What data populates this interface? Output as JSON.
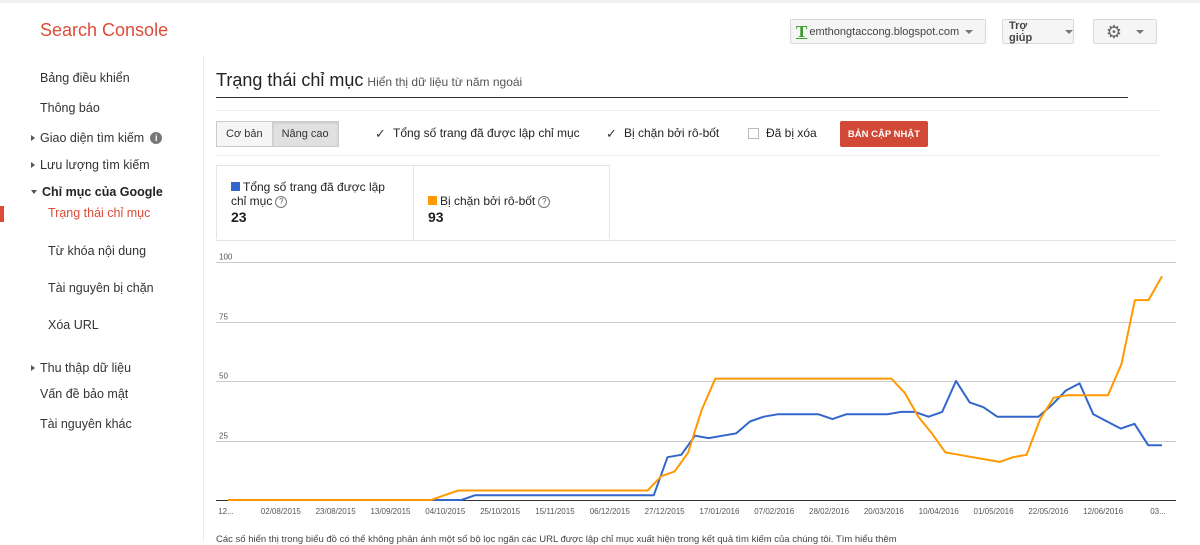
{
  "header": {
    "app_title": "Search Console",
    "site": "emthongtaccong.blogspot.com",
    "site_icon_letter": "T",
    "help_label": "Trợ giúp",
    "settings_icon": "gear-icon",
    "brand_color": "#dd4b39"
  },
  "sidebar": {
    "items": [
      {
        "label": "Bảng điều khiển"
      },
      {
        "label": "Thông báo"
      },
      {
        "label": "Giao diện tìm kiếm"
      },
      {
        "label": "Lưu lượng tìm kiếm"
      },
      {
        "label": "Chỉ mục của Google"
      },
      {
        "label": "Trạng thái chỉ mục"
      },
      {
        "label": "Từ khóa nội dung"
      },
      {
        "label": "Tài nguyên bị chặn"
      },
      {
        "label": "Xóa URL"
      },
      {
        "label": "Thu thập dữ liệu"
      },
      {
        "label": "Vấn đề bảo mật"
      },
      {
        "label": "Tài nguyên khác"
      }
    ]
  },
  "main": {
    "title": "Trạng thái chỉ mục",
    "subtitle": "Hiển thị dữ liệu từ năm ngoái",
    "tabs": [
      {
        "label": "Cơ bản"
      },
      {
        "label": "Nâng cao"
      }
    ],
    "checkboxes": [
      {
        "label": "Tổng số trang đã được lập chỉ mục",
        "checked": true
      },
      {
        "label": "Bị chặn bởi rô-bốt",
        "checked": true
      },
      {
        "label": "Đã bị xóa",
        "checked": false
      }
    ],
    "update_button": "BẢN CẬP NHẬT",
    "stats": [
      {
        "label": "Tổng số trang đã được lập chỉ mục",
        "value": "23",
        "color": "#3366cc"
      },
      {
        "label": "Bị chặn bởi rô-bốt",
        "value": "93",
        "color": "#ff9900"
      }
    ],
    "footnote": "Các số hiển thị trong biểu đồ có thể không phản ánh một số bộ lọc ngăn các URL được lập chỉ mục xuất hiện trong kết quả tìm kiếm của chúng tôi. Tìm hiểu thêm"
  },
  "chart_data": {
    "type": "line",
    "title": "",
    "xlabel": "",
    "ylabel": "",
    "ylim": [
      0,
      100
    ],
    "y_ticks": [
      25,
      50,
      75,
      100
    ],
    "grid": true,
    "x_tick_labels": [
      "12...",
      "02/08/2015",
      "23/08/2015",
      "13/09/2015",
      "04/10/2015",
      "25/10/2015",
      "15/11/2015",
      "06/12/2015",
      "27/12/2015",
      "17/01/2016",
      "07/02/2016",
      "28/02/2016",
      "20/03/2016",
      "10/04/2016",
      "01/05/2016",
      "22/05/2016",
      "12/06/2016",
      "03..."
    ],
    "series": [
      {
        "name": "Tổng số trang đã được lập chỉ mục",
        "color": "#3366cc",
        "values": [
          0,
          0,
          0,
          0,
          0,
          0,
          0,
          0,
          0,
          0,
          0,
          0,
          0,
          0,
          0,
          0,
          0,
          0,
          2,
          2,
          2,
          2,
          2,
          2,
          2,
          2,
          2,
          2,
          2,
          2,
          2,
          2,
          18,
          19,
          27,
          26,
          27,
          28,
          33,
          35,
          36,
          36,
          36,
          36,
          34,
          36,
          36,
          36,
          36,
          37,
          37,
          35,
          37,
          50,
          41,
          39,
          35,
          35,
          35,
          35,
          40,
          46,
          49,
          36,
          33,
          30,
          32,
          23,
          23
        ]
      },
      {
        "name": "Bị chặn bởi rô-bốt",
        "color": "#ff9900",
        "values": [
          0,
          0,
          0,
          0,
          0,
          0,
          0,
          0,
          0,
          0,
          0,
          0,
          0,
          0,
          0,
          0,
          2,
          4,
          4,
          4,
          4,
          4,
          4,
          4,
          4,
          4,
          4,
          4,
          4,
          4,
          4,
          4,
          10,
          12,
          20,
          38,
          51,
          51,
          51,
          51,
          51,
          51,
          51,
          51,
          51,
          51,
          51,
          51,
          51,
          51,
          45,
          35,
          28,
          20,
          19,
          18,
          17,
          16,
          18,
          19,
          34,
          43,
          44,
          44,
          44,
          44,
          57,
          84,
          84,
          94
        ]
      }
    ]
  }
}
